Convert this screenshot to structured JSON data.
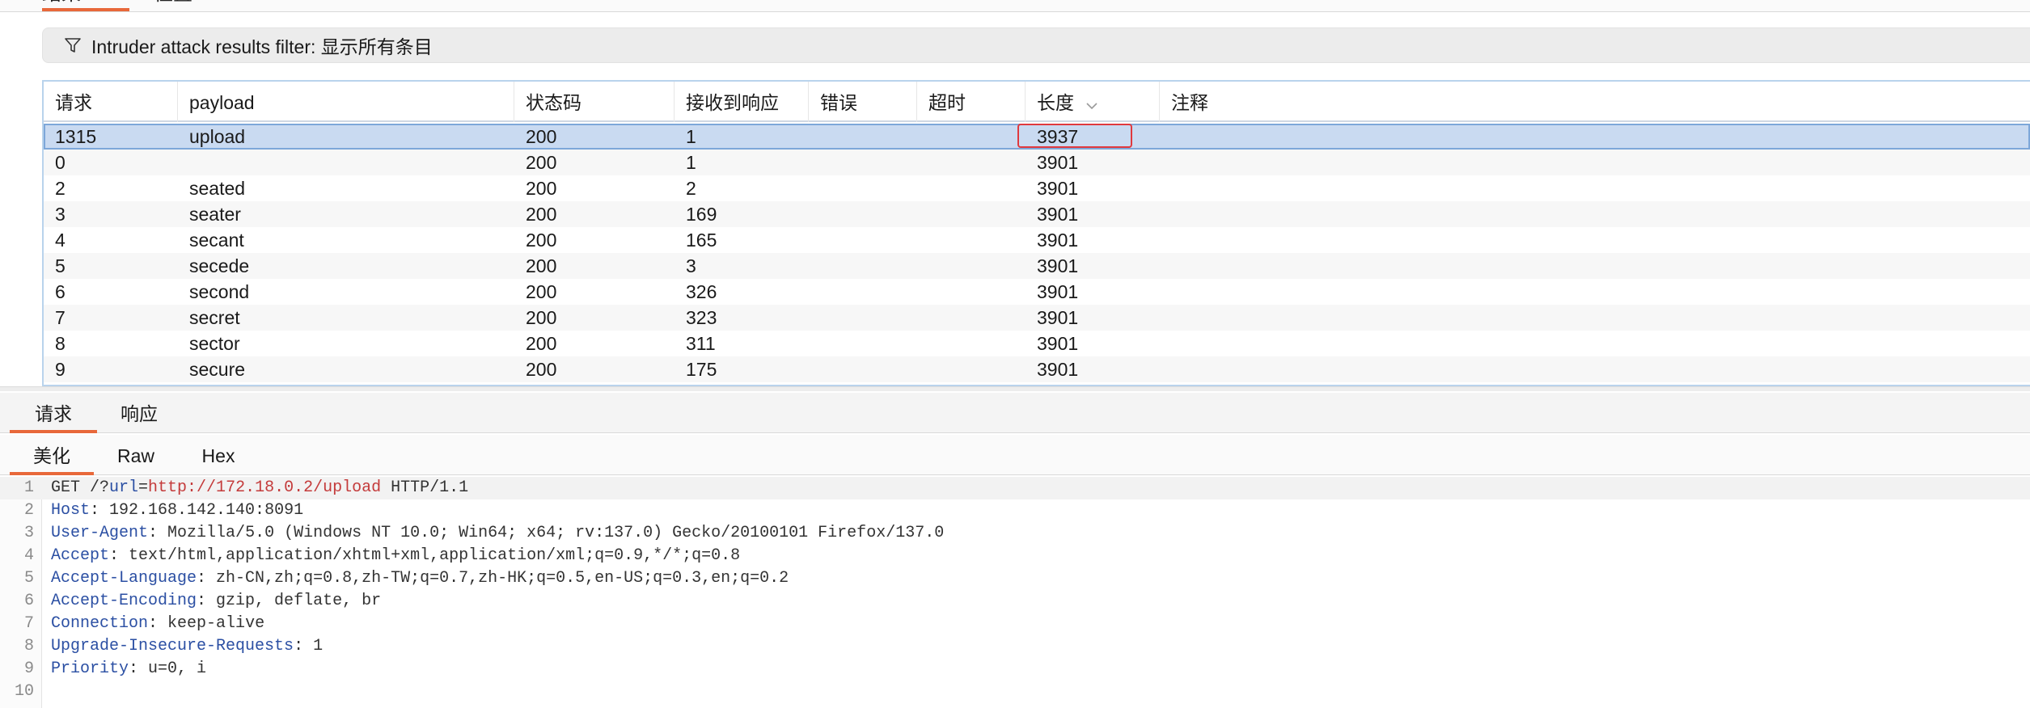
{
  "top_tabs": [
    "结果",
    "位置"
  ],
  "filter": {
    "icon": "filter-icon",
    "text": "Intruder attack results filter: 显示所有条目"
  },
  "table": {
    "columns": [
      "请求",
      "payload",
      "状态码",
      "接收到响应",
      "错误",
      "超时",
      "长度",
      "注释"
    ],
    "sorted_column": "长度",
    "rows": [
      {
        "req": "1315",
        "payload": "upload",
        "status": "200",
        "received": "1",
        "error": "",
        "timeout": "",
        "length": "3937",
        "comment": ""
      },
      {
        "req": "0",
        "payload": "",
        "status": "200",
        "received": "1",
        "error": "",
        "timeout": "",
        "length": "3901",
        "comment": ""
      },
      {
        "req": "2",
        "payload": "seated",
        "status": "200",
        "received": "2",
        "error": "",
        "timeout": "",
        "length": "3901",
        "comment": ""
      },
      {
        "req": "3",
        "payload": "seater",
        "status": "200",
        "received": "169",
        "error": "",
        "timeout": "",
        "length": "3901",
        "comment": ""
      },
      {
        "req": "4",
        "payload": "secant",
        "status": "200",
        "received": "165",
        "error": "",
        "timeout": "",
        "length": "3901",
        "comment": ""
      },
      {
        "req": "5",
        "payload": "secede",
        "status": "200",
        "received": "3",
        "error": "",
        "timeout": "",
        "length": "3901",
        "comment": ""
      },
      {
        "req": "6",
        "payload": "second",
        "status": "200",
        "received": "326",
        "error": "",
        "timeout": "",
        "length": "3901",
        "comment": ""
      },
      {
        "req": "7",
        "payload": "secret",
        "status": "200",
        "received": "323",
        "error": "",
        "timeout": "",
        "length": "3901",
        "comment": ""
      },
      {
        "req": "8",
        "payload": "sector",
        "status": "200",
        "received": "311",
        "error": "",
        "timeout": "",
        "length": "3901",
        "comment": ""
      },
      {
        "req": "9",
        "payload": "secure",
        "status": "200",
        "received": "175",
        "error": "",
        "timeout": "",
        "length": "3901",
        "comment": ""
      }
    ]
  },
  "message_tabs": [
    "请求",
    "响应"
  ],
  "view_tabs": [
    "美化",
    "Raw",
    "Hex"
  ],
  "editor": {
    "request_line": {
      "prefix": "GET /?",
      "query_key": "url",
      "equals": "=",
      "query_value": "http://172.18.0.2/upload",
      "suffix": " HTTP/1.1"
    },
    "headers": [
      {
        "name": "Host",
        "value": "192.168.142.140:8091"
      },
      {
        "name": "User-Agent",
        "value": "Mozilla/5.0 (Windows NT 10.0; Win64; x64; rv:137.0) Gecko/20100101 Firefox/137.0"
      },
      {
        "name": "Accept",
        "value": "text/html,application/xhtml+xml,application/xml;q=0.9,*/*;q=0.8"
      },
      {
        "name": "Accept-Language",
        "value": "zh-CN,zh;q=0.8,zh-TW;q=0.7,zh-HK;q=0.5,en-US;q=0.3,en;q=0.2"
      },
      {
        "name": "Accept-Encoding",
        "value": "gzip, deflate, br"
      },
      {
        "name": "Connection",
        "value": "keep-alive"
      },
      {
        "name": "Upgrade-Insecure-Requests",
        "value": "1"
      },
      {
        "name": "Priority",
        "value": "u=0, i"
      }
    ],
    "line_numbers": [
      "1",
      "2",
      "3",
      "4",
      "5",
      "6",
      "7",
      "8",
      "9",
      "10"
    ]
  },
  "colors": {
    "accent_underline": "#e8683a",
    "selected_row": "#c9daf1",
    "highlight_box": "#e0393e",
    "header_name": "#2b4fa3",
    "query_value": "#c43b3b"
  }
}
